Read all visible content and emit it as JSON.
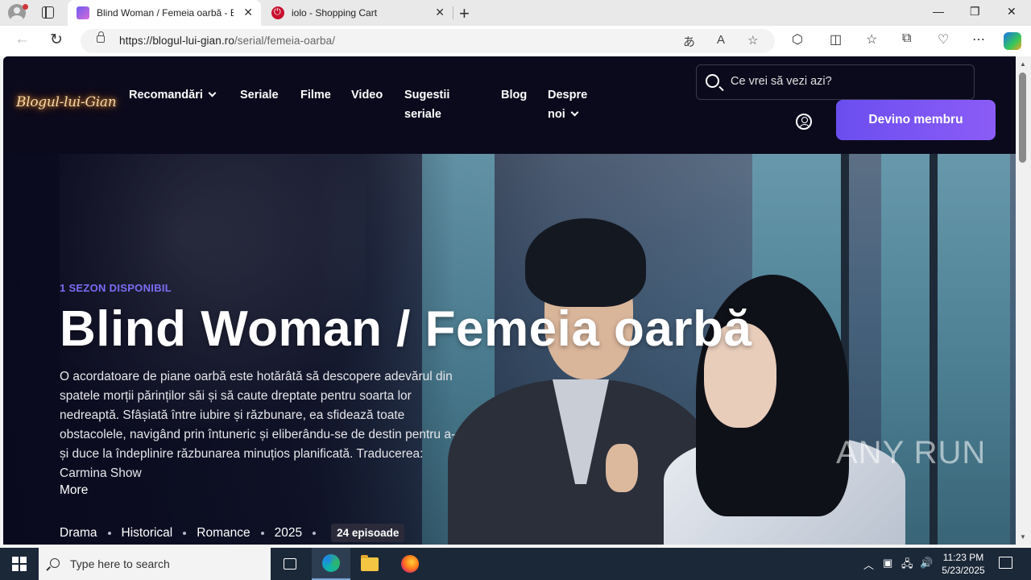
{
  "browser": {
    "tabs": [
      {
        "title": "Blind Woman / Femeia oarbă - B",
        "active": true,
        "icon": "blog-favicon"
      },
      {
        "title": "iolo - Shopping Cart",
        "active": false,
        "icon": "iolo-favicon"
      }
    ],
    "url_domain": "https://blogul-lui-gian.ro",
    "url_path": "/serial/femeia-oarba/"
  },
  "site": {
    "logo_text": "Blogul-lui-Gian",
    "nav": [
      {
        "label": "Recomandări",
        "has_dropdown": true
      },
      {
        "label": "Seriale",
        "has_dropdown": false
      },
      {
        "label": "Filme",
        "has_dropdown": false
      },
      {
        "label": "Video",
        "has_dropdown": false
      },
      {
        "label": "Sugestii",
        "label2": "seriale",
        "has_dropdown": false
      },
      {
        "label": "Blog",
        "has_dropdown": false
      },
      {
        "label": "Despre",
        "label2": "noi",
        "has_dropdown": true
      }
    ],
    "search_placeholder": "Ce vrei să vezi azi?",
    "member_button": "Devino membru",
    "accent_color": "#7c6cf5"
  },
  "hero": {
    "season": "1 SEZON DISPONIBIL",
    "title": "Blind Woman / Femeia oarbă",
    "description": "O acordatoare de piane oarbă este hotărâtă să descopere adevărul din spatele morții părinților săi și să caute dreptate pentru soarta lor nedreaptă. Sfâșiată între iubire și răzbunare, ea sfidează toate obstacolele, navigând prin întuneric și eliberându-se de destin pentru a-și duce la îndeplinire răzbunarea minuțios planificată. Traducerea: Carmina Show",
    "more": "More",
    "genres": [
      "Drama",
      "Historical",
      "Romance"
    ],
    "year": "2025",
    "episodes": "24 episoade"
  },
  "watermark": "ANY RUN",
  "taskbar": {
    "search_placeholder": "Type here to search",
    "time": "11:23 PM",
    "date": "5/23/2025"
  }
}
